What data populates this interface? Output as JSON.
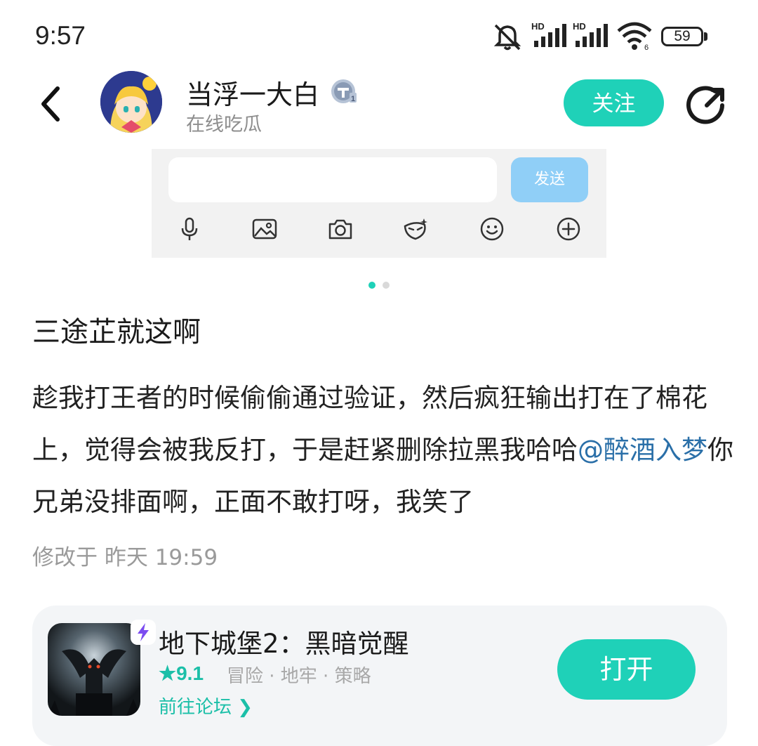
{
  "status_bar": {
    "time": "9:57",
    "battery": "59",
    "signal_labels": [
      "HD",
      "HD"
    ]
  },
  "header": {
    "username": "当浮一大白",
    "subtitle": "在线吃瓜",
    "follow_label": "关注",
    "accent_color": "#1fd1b8"
  },
  "embed": {
    "send_label": "发送",
    "icons": [
      "microphone-icon",
      "image-icon",
      "camera-icon",
      "sticker-icon",
      "emoji-icon",
      "plus-icon"
    ]
  },
  "post": {
    "title": "三途芷就这啊",
    "body_part1": "趁我打王者的时候偷偷通过验证，然后疯狂输出打在了棉花上，觉得会被我反打，于是赶紧删除拉黑我哈哈",
    "mention": "@醉酒入梦",
    "body_part2": "你兄弟没排面啊，正面不敢打呀，我笑了",
    "meta": "修改于 昨天 19:59"
  },
  "game_card": {
    "name": "地下城堡2：黑暗觉醒",
    "rating": "★9.1",
    "tags": "冒险 · 地牢 · 策略",
    "forum_link": "前往论坛 ❯",
    "open_label": "打开"
  }
}
